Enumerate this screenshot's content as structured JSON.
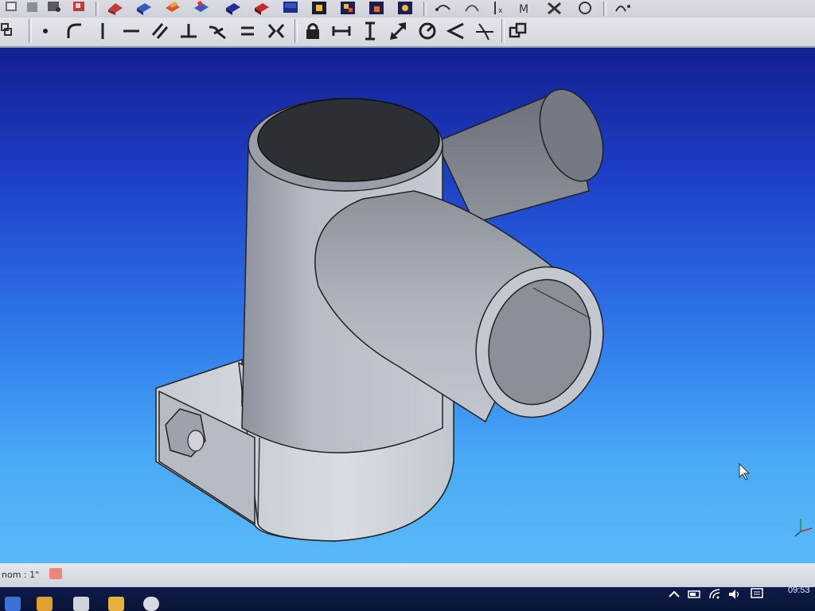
{
  "toolbar_top": {
    "icons": [
      "view-front-icon",
      "view-top-icon",
      "view-right-icon",
      "view-rear-icon",
      "view-bottom-icon",
      "view-left-icon",
      "part-icon",
      "box-icon",
      "cylinder-icon",
      "sphere-icon",
      "cone-icon",
      "torus-icon",
      "boolean-icon",
      "fillet-icon",
      "chamfer-icon",
      "mirror-icon",
      "constraint-coincident-icon",
      "constraint-pointonobject-icon",
      "constraint-fix-icon",
      "constraint-symmetric-icon",
      "constraint-lock-icon",
      "constraint-tools-icon"
    ]
  },
  "sketch_toolbar": {
    "icons": [
      "layout-icon",
      "point-icon",
      "arc-icon",
      "vertical-line-icon",
      "horizontal-line-icon",
      "parallel-icon",
      "perpendicular-icon",
      "tangent-icon",
      "equal-icon",
      "symmetric-icon",
      "lock-icon",
      "horizontal-distance-icon",
      "vertical-distance-icon",
      "distance-icon",
      "radius-icon",
      "angle-icon",
      "snell-law-icon",
      "toggle-construction-icon"
    ]
  },
  "viewport": {
    "background_top": "#13208f",
    "background_bottom": "#5ab9f7",
    "model_color": "#b9bdc6"
  },
  "status_bar": {
    "text": "nom : 1\""
  },
  "taskbar": {
    "clock": "09:53",
    "tray_icons": [
      "chevron-up-icon",
      "battery-icon",
      "wifi-icon",
      "volume-icon",
      "notification-icon"
    ]
  }
}
